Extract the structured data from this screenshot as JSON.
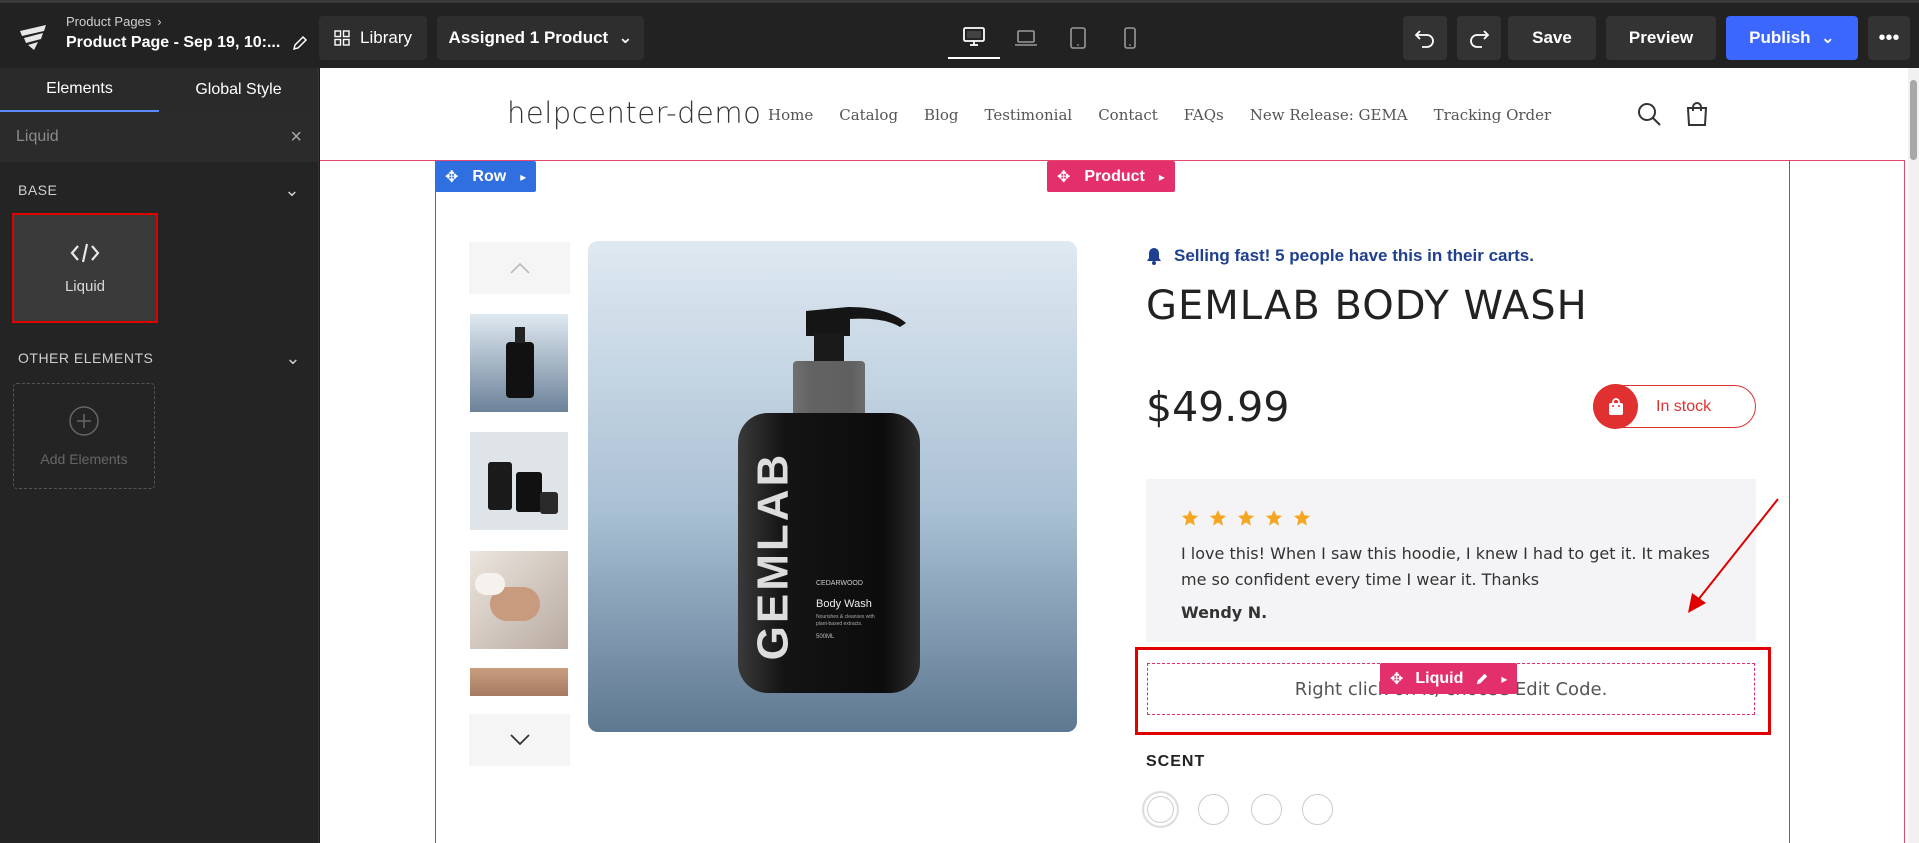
{
  "topbar": {
    "breadcrumb": "Product Pages",
    "page_name": "Product Page - Sep 19, 10:...",
    "library": "Library",
    "assigned": "Assigned 1 Product",
    "save": "Save",
    "preview": "Preview",
    "publish": "Publish",
    "devices": [
      "desktop",
      "laptop",
      "tablet",
      "mobile"
    ],
    "active_device": "desktop"
  },
  "sidebar": {
    "tabs": [
      "Elements",
      "Global Style"
    ],
    "active_tab": "Elements",
    "search_value": "Liquid",
    "base_label": "BASE",
    "liquid_item": "Liquid",
    "other_label": "OTHER ELEMENTS",
    "add_elements": "Add Elements"
  },
  "store": {
    "logo": "helpcenter-demo",
    "nav": [
      "Home",
      "Catalog",
      "Blog",
      "Testimonial",
      "Contact",
      "FAQs",
      "New Release: GEMA",
      "Tracking Order"
    ]
  },
  "editor_tags": {
    "row": "Row",
    "product": "Product",
    "liquid": "Liquid"
  },
  "product": {
    "selling": "Selling fast! 5 people have this in their carts.",
    "title": "GEMLAB BODY WASH",
    "price": "$49.99",
    "stock": "In stock",
    "bottle_brand": "GEMLAB",
    "bottle_scent": "CEDARWOOD",
    "bottle_name": "Body Wash",
    "bottle_desc": "Nourishes & cleanses with plant-based extracts.",
    "bottle_size": "500ML",
    "review": {
      "stars": 5,
      "text": "I love this! When I saw this hoodie, I knew I had to get it. It makes me so confident every time I wear it. Thanks",
      "author": "Wendy N."
    },
    "liquid_placeholder": "Right click on it, choose Edit Code.",
    "scent_label": "SCENT",
    "swatch_count": 4
  },
  "colors": {
    "publish": "#3c67ff",
    "row_tag": "#2f6fe0",
    "product_tag": "#e3306c",
    "highlight": "#e00000",
    "star": "#f5a623"
  }
}
